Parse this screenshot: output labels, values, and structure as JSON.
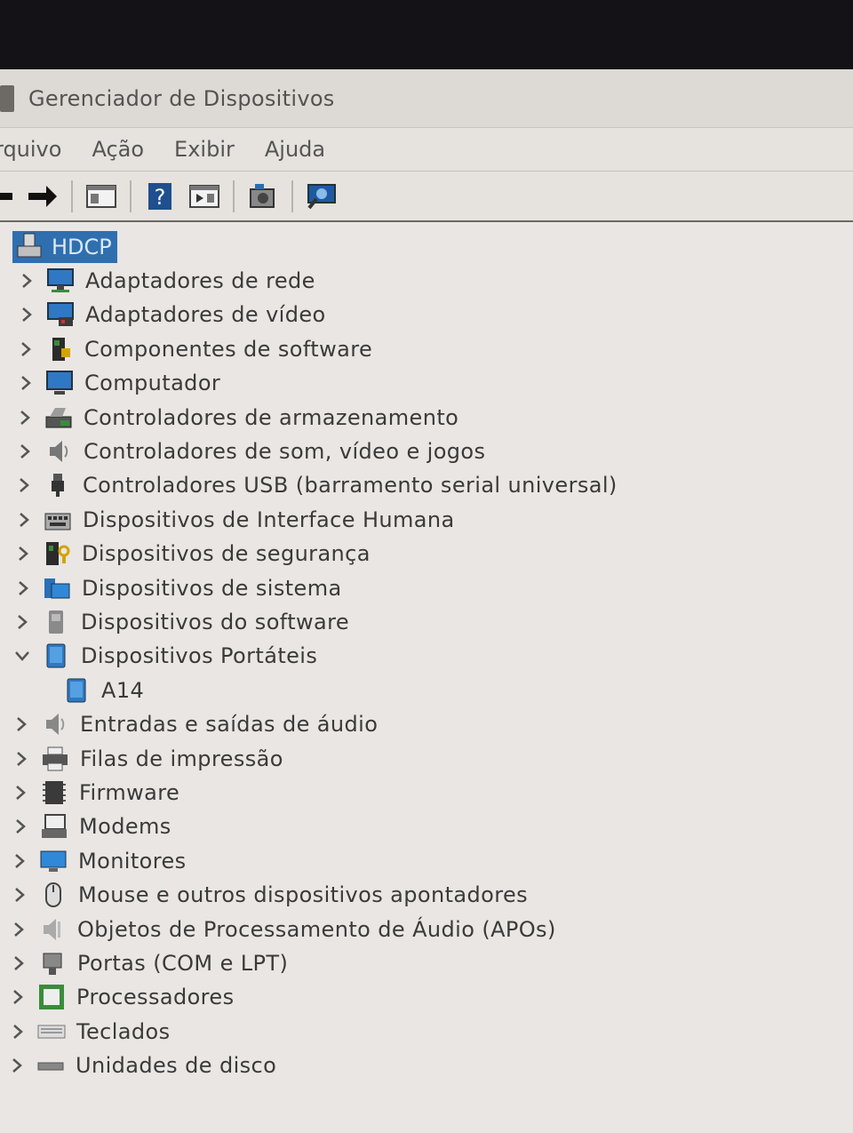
{
  "window": {
    "title": "Gerenciador de Dispositivos"
  },
  "menu": [
    "rquivo",
    "Ação",
    "Exibir",
    "Ajuda"
  ],
  "toolbar": {
    "buttons": [
      "back-arrow-icon",
      "forward-arrow-icon",
      "properties-icon",
      "help-icon",
      "show-hidden-icon",
      "update-driver-icon",
      "scan-hardware-icon"
    ]
  },
  "tree": {
    "root": "HDCP",
    "categories": [
      {
        "label": "Adaptadores de rede",
        "icon": "network-adapter-icon",
        "expanded": false
      },
      {
        "label": "Adaptadores de vídeo",
        "icon": "display-adapter-icon",
        "expanded": false
      },
      {
        "label": "Componentes de software",
        "icon": "software-component-icon",
        "expanded": false
      },
      {
        "label": "Computador",
        "icon": "computer-icon",
        "expanded": false
      },
      {
        "label": "Controladores de armazenamento",
        "icon": "storage-controller-icon",
        "expanded": false
      },
      {
        "label": "Controladores de som, vídeo e jogos",
        "icon": "speaker-icon",
        "expanded": false
      },
      {
        "label": "Controladores USB (barramento serial universal)",
        "icon": "usb-icon",
        "expanded": false
      },
      {
        "label": "Dispositivos de Interface Humana",
        "icon": "hid-icon",
        "expanded": false
      },
      {
        "label": "Dispositivos de segurança",
        "icon": "security-device-icon",
        "expanded": false
      },
      {
        "label": "Dispositivos de sistema",
        "icon": "system-device-icon",
        "expanded": false
      },
      {
        "label": "Dispositivos do software",
        "icon": "software-device-icon",
        "expanded": false
      },
      {
        "label": "Dispositivos Portáteis",
        "icon": "portable-device-icon",
        "expanded": true,
        "children": [
          "A14"
        ]
      },
      {
        "label": "Entradas e saídas de áudio",
        "icon": "audio-io-icon",
        "expanded": false
      },
      {
        "label": "Filas de impressão",
        "icon": "printer-icon",
        "expanded": false
      },
      {
        "label": "Firmware",
        "icon": "firmware-icon",
        "expanded": false
      },
      {
        "label": "Modems",
        "icon": "modem-icon",
        "expanded": false
      },
      {
        "label": "Monitores",
        "icon": "monitor-icon",
        "expanded": false
      },
      {
        "label": "Mouse e outros dispositivos apontadores",
        "icon": "mouse-icon",
        "expanded": false
      },
      {
        "label": "Objetos de Processamento de Áudio (APOs)",
        "icon": "audio-processing-icon",
        "expanded": false
      },
      {
        "label": "Portas (COM e LPT)",
        "icon": "port-icon",
        "expanded": false
      },
      {
        "label": "Processadores",
        "icon": "processor-icon",
        "expanded": false
      },
      {
        "label": "Teclados",
        "icon": "keyboard-icon",
        "expanded": false
      },
      {
        "label": "Unidades de disco",
        "icon": "disk-drive-icon",
        "expanded": false
      }
    ]
  },
  "colors": {
    "selection": "#2f6fb0",
    "icon_blue": "#2f78c4"
  }
}
